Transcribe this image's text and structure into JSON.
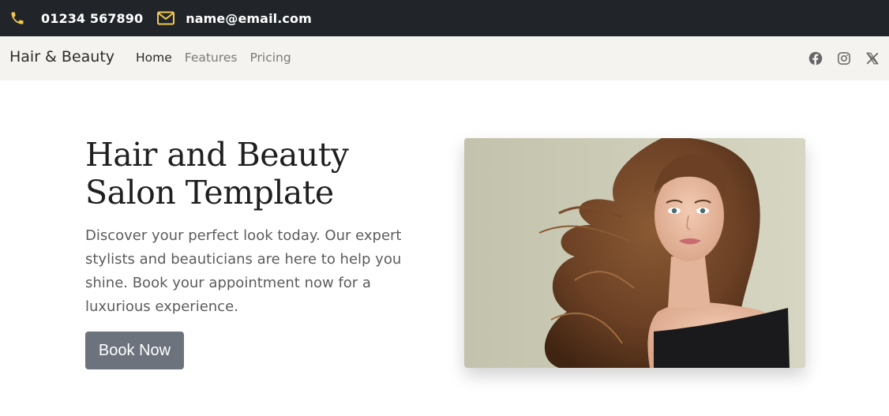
{
  "topbar": {
    "phone": {
      "icon": "phone-icon",
      "text": "01234 567890"
    },
    "email": {
      "icon": "envelope-icon",
      "text": "name@email.com"
    }
  },
  "navbar": {
    "brand": "Hair & Beauty",
    "links": [
      {
        "label": "Home",
        "active": true
      },
      {
        "label": "Features",
        "active": false
      },
      {
        "label": "Pricing",
        "active": false
      }
    ],
    "social": [
      "facebook-icon",
      "instagram-icon",
      "x-icon"
    ]
  },
  "hero": {
    "title": "Hair and Beauty Salon Template",
    "text": "Discover your perfect look today. Our expert stylists and beauticians are here to help you shine. Book your appointment now for a luxurious experience.",
    "button_label": "Book Now",
    "image": "portrait-photo"
  },
  "colors": {
    "topbar_bg": "#212529",
    "icon_gold": "#f2c94c",
    "navbar_bg": "#f5f3ef",
    "button_bg": "#6c737d"
  }
}
